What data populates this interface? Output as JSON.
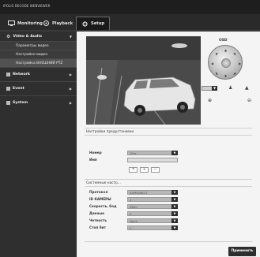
{
  "app": {
    "brand": "IPOLIS DECODE WEBVIEWER"
  },
  "tabs": [
    {
      "label": "Monitoring",
      "icon": "monitor-icon"
    },
    {
      "label": "Playback",
      "icon": "playback-icon"
    },
    {
      "label": "Setup",
      "icon": "setup-icon"
    }
  ],
  "sidebar": {
    "section": {
      "label": "Video & Audio",
      "icon": "gear-icon"
    },
    "subitems": [
      {
        "label": "Параметры видео"
      },
      {
        "label": "Настройки видео"
      },
      {
        "label": "Настройка ВНЕШНИЙ PTZ"
      }
    ],
    "items": [
      {
        "label": "Network"
      },
      {
        "label": "Event"
      },
      {
        "label": "System"
      }
    ]
  },
  "ptz": {
    "label": "OSD"
  },
  "preset_section": {
    "title": "Настройки предустановки",
    "number_label": "Номер",
    "number_value": "1Pre",
    "name_label": "Имя"
  },
  "control_section": {
    "title": "Системные настр...",
    "fields": [
      {
        "label": "Протокол",
        "value": "SAMSUNG-T"
      },
      {
        "label": "ID КАМЕРЫ",
        "value": "1"
      },
      {
        "label": "Скорость, бод",
        "value": "9600"
      },
      {
        "label": "Данные",
        "value": "8"
      },
      {
        "label": "Четность",
        "value": "None"
      },
      {
        "label": "Стоп бит",
        "value": "1"
      }
    ]
  },
  "apply_label": "Применить",
  "colors": {
    "header": "#1e1e1e",
    "sidebar": "#2f2f2f",
    "button": "#2d2d2d"
  }
}
